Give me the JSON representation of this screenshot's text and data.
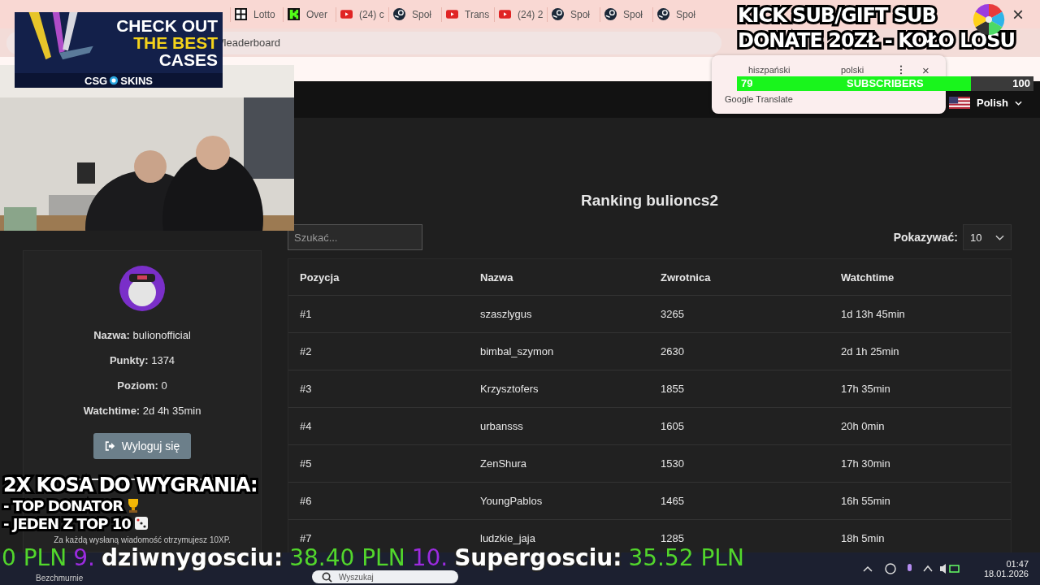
{
  "browser": {
    "tabs": [
      {
        "label": "Lotto",
        "kind": "grid"
      },
      {
        "label": "Over",
        "kind": "k"
      },
      {
        "label": "(24) c",
        "kind": "video"
      },
      {
        "label": "Społ",
        "kind": "steam"
      },
      {
        "label": "Trans",
        "kind": "video"
      },
      {
        "label": "(24) 2",
        "kind": "video"
      },
      {
        "label": "Społ",
        "kind": "steam"
      },
      {
        "label": "Społ",
        "kind": "steam"
      },
      {
        "label": "Społ",
        "kind": "steam"
      }
    ],
    "address": "/leaderboard",
    "close": "×"
  },
  "header": {
    "language": "Polish"
  },
  "profile": {
    "fields": [
      {
        "label": "Nazwa:",
        "value": "bulionofficial"
      },
      {
        "label": "Punkty:",
        "value": "1374"
      },
      {
        "label": "Poziom:",
        "value": "0"
      },
      {
        "label": "Watchtime:",
        "value": "2d 4h 35min"
      }
    ],
    "logout": "Wyloguj się",
    "note": "Za każdą wysłaną wiadomość otrzymujesz 10XP."
  },
  "leaderboard": {
    "title": "Ranking bulioncs2",
    "search": {
      "placeholder": "Szukać..."
    },
    "page_size": {
      "label": "Pokazywać:",
      "value": "10"
    },
    "columns": [
      "Pozycja",
      "Nazwa",
      "Zwrotnica",
      "Watchtime"
    ],
    "rows": [
      [
        "#1",
        "szaszlygus",
        "3265",
        "1d 13h 45min"
      ],
      [
        "#2",
        "bimbal_szymon",
        "2630",
        "2d 1h 25min"
      ],
      [
        "#3",
        "Krzysztofers",
        "1855",
        "17h 35min"
      ],
      [
        "#4",
        "urbansss",
        "1605",
        "20h 0min"
      ],
      [
        "#5",
        "ZenShura",
        "1530",
        "17h 30min"
      ],
      [
        "#6",
        "YoungPablos",
        "1465",
        "16h 55min"
      ],
      [
        "#7",
        "ludzkie_jaja",
        "1285",
        "18h 5min"
      ]
    ]
  },
  "translate_popup": {
    "source": "hiszpański",
    "target": "polski",
    "brand": "Google Translate",
    "close": "×"
  },
  "overlays": {
    "ad": {
      "lines": [
        {
          "text": "CHECK OUT",
          "highlight": false
        },
        {
          "text": "THE BEST",
          "highlight": true
        },
        {
          "text": "CASES",
          "highlight": false
        }
      ],
      "brand_left": "CSG",
      "brand_right": "SKINS"
    },
    "sub_goal": {
      "lines": [
        "KICK SUB/GIFT SUB",
        "DONATE 20ZŁ - KOŁO LOSU"
      ]
    },
    "subscribers": {
      "count": "79",
      "label": "SUBSCRIBERS",
      "goal": "100",
      "level": 0.79
    },
    "giveaway": {
      "title": "2X KOSA DO WYGRANIA:",
      "items": [
        {
          "text": "- TOP DONATOR",
          "kind": "trophy"
        },
        {
          "text": "- JEDEN Z TOP 10",
          "kind": "dice"
        }
      ]
    },
    "ticker": [
      {
        "kind": "amount",
        "text": "0 PLN"
      },
      {
        "kind": "rank",
        "text": "9."
      },
      {
        "kind": "name",
        "text": "dziwnygosciu:"
      },
      {
        "kind": "amount",
        "text": "38.40 PLN"
      },
      {
        "kind": "rank",
        "text": "10."
      },
      {
        "kind": "name",
        "text": "Supergosciu:"
      },
      {
        "kind": "amount",
        "text": "35.52 PLN"
      }
    ]
  },
  "taskbar": {
    "weather": {
      "condition": "Bezchmurnie"
    },
    "search": {
      "placeholder": "Wyszukaj"
    },
    "time": "01:47",
    "date": "18.01.2026"
  }
}
